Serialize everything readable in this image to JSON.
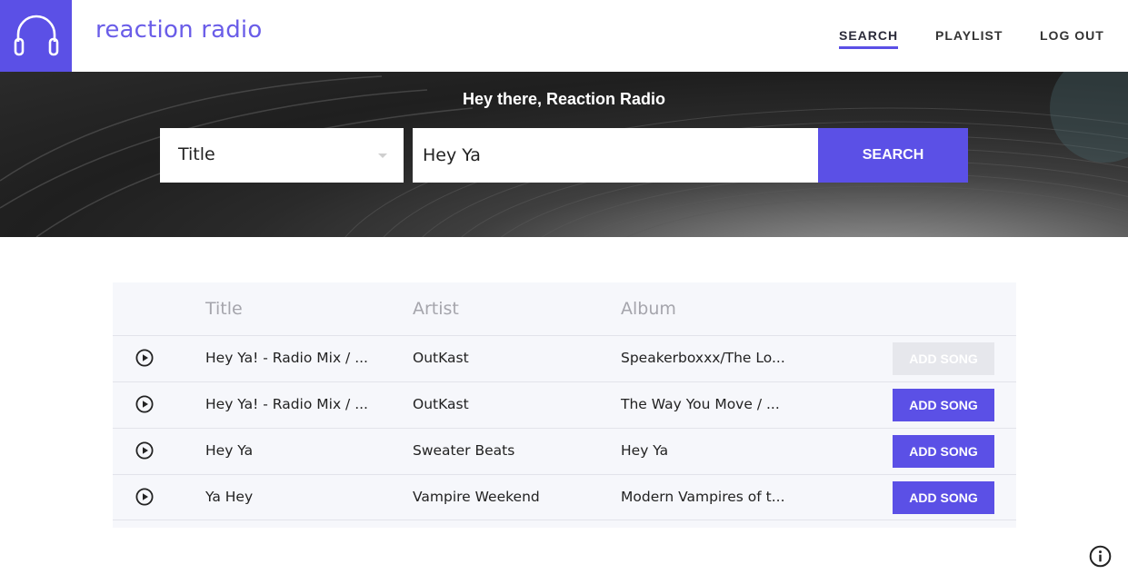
{
  "header": {
    "brand": "reaction radio",
    "logo_icon": "headphones-icon",
    "nav": [
      {
        "label": "SEARCH",
        "active": true
      },
      {
        "label": "PLAYLIST",
        "active": false
      },
      {
        "label": "LOG OUT",
        "active": false
      }
    ]
  },
  "hero": {
    "greeting": "Hey there, Reaction Radio",
    "search_by": "Title",
    "query": "Hey Ya",
    "search_label": "SEARCH"
  },
  "results": {
    "columns": [
      "Title",
      "Artist",
      "Album"
    ],
    "rows": [
      {
        "title": "Hey Ya! - Radio Mix / ...",
        "artist": "OutKast",
        "album": "Speakerboxxx/The Lo...",
        "button": "ADD SONG",
        "disabled": true
      },
      {
        "title": "Hey Ya! - Radio Mix / ...",
        "artist": "OutKast",
        "album": "The Way You Move / ...",
        "button": "ADD SONG",
        "disabled": false
      },
      {
        "title": "Hey Ya",
        "artist": "Sweater Beats",
        "album": "Hey Ya",
        "button": "ADD SONG",
        "disabled": false
      },
      {
        "title": "Ya Hey",
        "artist": "Vampire Weekend",
        "album": "Modern Vampires of t...",
        "button": "ADD SONG",
        "disabled": false
      }
    ]
  },
  "colors": {
    "accent": "#5b50e6",
    "brand_text": "#6a5de8",
    "disabled_button": "#e6e7ec",
    "table_bg": "#f6f7fb"
  }
}
